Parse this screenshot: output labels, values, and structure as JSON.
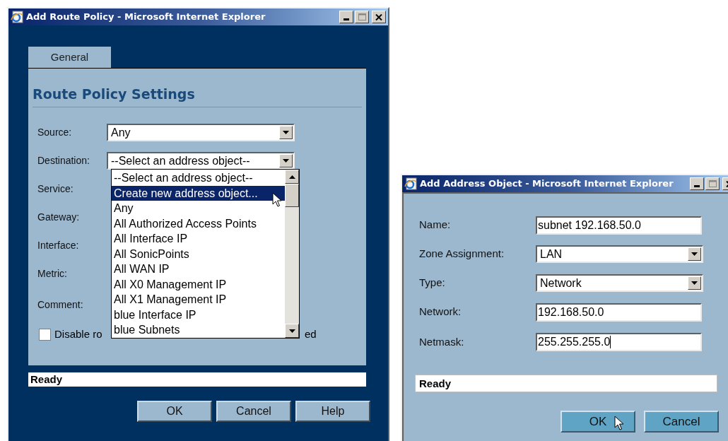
{
  "route_policy_window": {
    "title": "Add Route Policy - Microsoft Internet Explorer",
    "tabs": [
      {
        "label": "General",
        "selected": true
      }
    ],
    "heading": "Route Policy Settings",
    "fields": [
      {
        "label": "Source:",
        "kind": "select",
        "value": "Any"
      },
      {
        "label": "Destination:",
        "kind": "select",
        "value": "--Select an address object--"
      },
      {
        "label": "Service:",
        "kind": "covered"
      },
      {
        "label": "Gateway:",
        "kind": "covered"
      },
      {
        "label": "Interface:",
        "kind": "covered"
      },
      {
        "label": "Metric:",
        "kind": "covered"
      },
      {
        "label": "Comment:",
        "kind": "covered"
      }
    ],
    "dropdown_list": {
      "items": [
        {
          "label": "--Select an address object--",
          "selected": false
        },
        {
          "label": "Create new address object...",
          "selected": true
        },
        {
          "label": "Any",
          "selected": false
        },
        {
          "label": "All Authorized Access Points",
          "selected": false
        },
        {
          "label": "All Interface IP",
          "selected": false
        },
        {
          "label": "All SonicPoints",
          "selected": false
        },
        {
          "label": "All WAN IP",
          "selected": false
        },
        {
          "label": "All X0 Management IP",
          "selected": false
        },
        {
          "label": "All X1 Management IP",
          "selected": false
        },
        {
          "label": "blue Interface IP",
          "selected": false
        },
        {
          "label": "blue Subnets",
          "selected": false
        }
      ]
    },
    "checkbox": {
      "label_start": "Disable ro",
      "label_end": "ed",
      "checked": false
    },
    "status": "Ready",
    "buttons": [
      "OK",
      "Cancel",
      "Help"
    ]
  },
  "address_object_window": {
    "title": "Add Address Object - Microsoft Internet Explorer",
    "fields": [
      {
        "label": "Name:",
        "kind": "text",
        "value": "subnet 192.168.50.0",
        "focused": false
      },
      {
        "label": "Zone Assignment:",
        "kind": "select",
        "value": "LAN"
      },
      {
        "label": "Type:",
        "kind": "select",
        "value": "Network"
      },
      {
        "label": "Network:",
        "kind": "text",
        "value": "192.168.50.0",
        "focused": false
      },
      {
        "label": "Netmask:",
        "kind": "text",
        "value": "255.255.255.0",
        "focused": true
      }
    ],
    "status": "Ready",
    "buttons": [
      "OK",
      "Cancel"
    ]
  }
}
